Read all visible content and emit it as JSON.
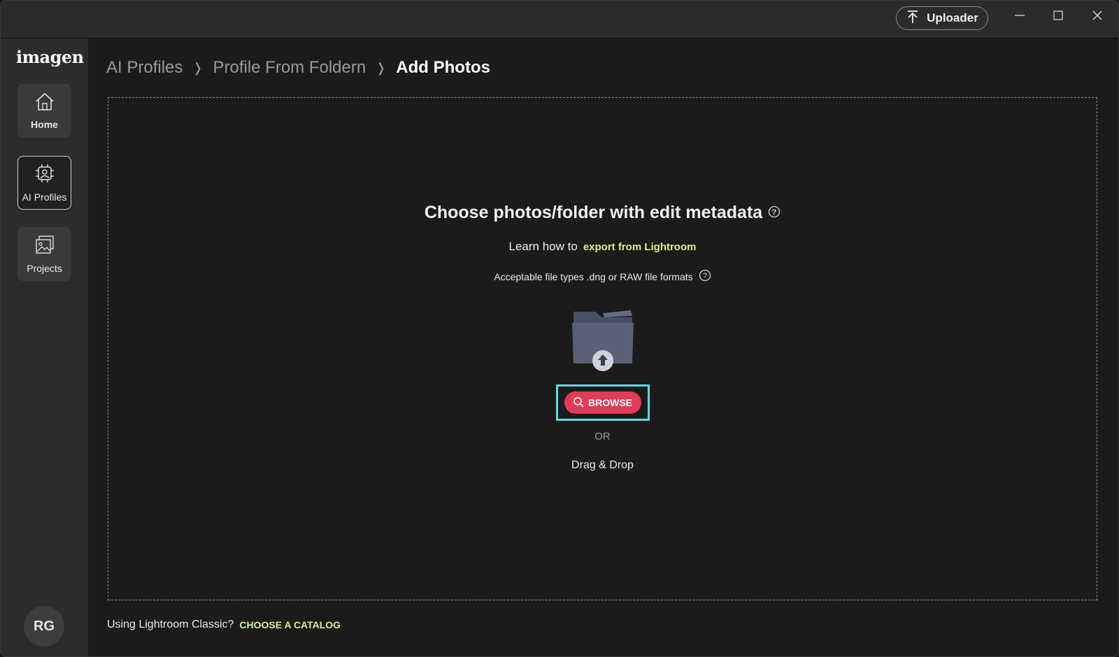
{
  "titlebar": {
    "uploader_label": "Uploader",
    "controls": {
      "minimize": "minimize",
      "maximize": "maximize",
      "close": "close"
    }
  },
  "sidebar": {
    "logo": "imagen",
    "items": [
      {
        "label": "Home",
        "icon": "home-icon",
        "active": false
      },
      {
        "label": "AI Profiles",
        "icon": "ai-profile-icon",
        "active": true
      },
      {
        "label": "Projects",
        "icon": "projects-icon",
        "active": false
      }
    ],
    "avatar_initials": "RG"
  },
  "breadcrumb": {
    "items": [
      "AI Profiles",
      "Profile From Foldern",
      "Add Photos"
    ]
  },
  "dropzone": {
    "title": "Choose photos/folder with edit metadata",
    "learn_prefix": "Learn how to",
    "learn_link": "export from Lightroom",
    "file_types": "Acceptable file types .dng or RAW file formats",
    "browse_label": "BROWSE",
    "or_label": "OR",
    "drag_drop_label": "Drag & Drop"
  },
  "footer": {
    "prefix": "Using Lightroom Classic?",
    "link": "CHOOSE A CATALOG"
  },
  "colors": {
    "accent_link": "#d6f28a",
    "browse_button": "#e03b57",
    "highlight_frame": "#5fd9e0",
    "sidebar_bg": "#2c2c2c",
    "content_bg": "#1b1b1b"
  }
}
